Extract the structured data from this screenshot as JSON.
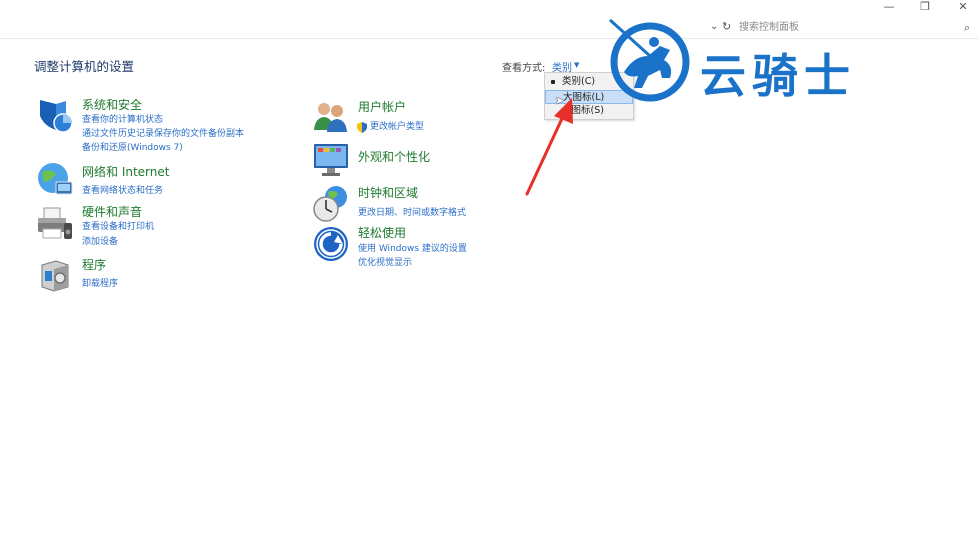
{
  "window": {
    "minimize_glyph": "—",
    "restore_glyph": "❐",
    "close_glyph": "✕"
  },
  "address": {
    "search_placeholder": "搜索控制面板"
  },
  "header": {
    "title": "调整计算机的设置",
    "view_by_label": "查看方式:",
    "view_by_value": "类别"
  },
  "dropdown": {
    "items": [
      "类别(C)",
      "大图标(L)",
      "小图标(S)"
    ],
    "selected_index": 0,
    "highlighted_index": 1
  },
  "left_categories": [
    {
      "title": "系统和安全",
      "links": [
        "查看你的计算机状态",
        "通过文件历史记录保存你的文件备份副本",
        "备份和还原(Windows 7)"
      ],
      "icon": "shield-icon"
    },
    {
      "title": "网络和 Internet",
      "links": [
        "查看网络状态和任务"
      ],
      "icon": "network-globe-icon"
    },
    {
      "title": "硬件和声音",
      "links": [
        "查看设备和打印机",
        "添加设备"
      ],
      "icon": "printer-icon"
    },
    {
      "title": "程序",
      "links": [
        "卸载程序"
      ],
      "icon": "programs-box-icon"
    }
  ],
  "right_categories": [
    {
      "title": "用户帐户",
      "links": [
        "更改帐户类型"
      ],
      "icon": "users-icon"
    },
    {
      "title": "外观和个性化",
      "links": [],
      "icon": "monitor-icon"
    },
    {
      "title": "时钟和区域",
      "links": [
        "更改日期、时间或数字格式"
      ],
      "icon": "clock-globe-icon"
    },
    {
      "title": "轻松使用",
      "links": [
        "使用 Windows 建议的设置",
        "优化视觉显示"
      ],
      "icon": "ease-of-access-icon"
    }
  ],
  "watermark": {
    "text": "云骑士"
  },
  "colors": {
    "link": "#2b6ec7",
    "category_title": "#1e7a2e",
    "brand": "#1a73c9",
    "arrow": "#e8302a"
  }
}
